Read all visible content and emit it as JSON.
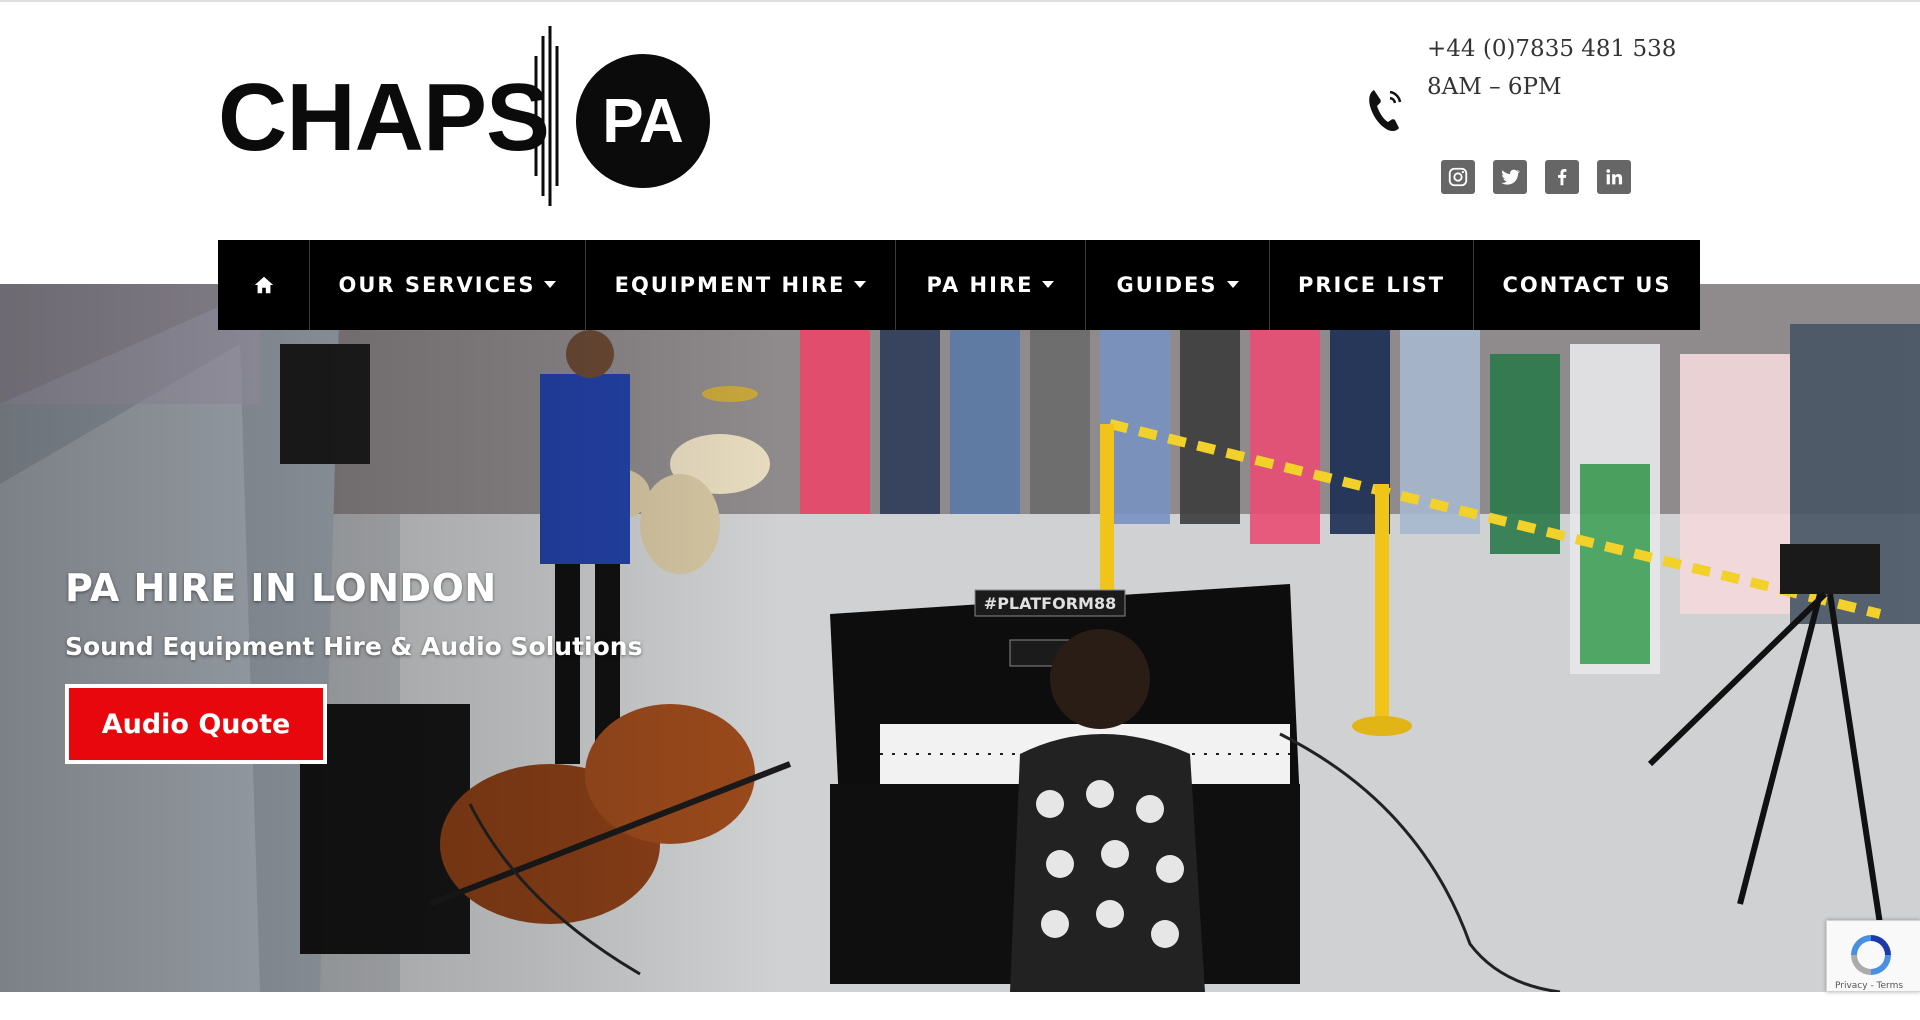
{
  "brand": {
    "name_left": "CHAPS",
    "name_right": "PA"
  },
  "contact": {
    "phone": "+44 (0)7835 481 538",
    "hours": "8AM – 6PM",
    "icon": "phone-icon"
  },
  "socials": [
    {
      "name": "instagram",
      "icon": "instagram-icon"
    },
    {
      "name": "twitter",
      "icon": "twitter-icon"
    },
    {
      "name": "facebook",
      "icon": "facebook-icon"
    },
    {
      "name": "linkedin",
      "icon": "linkedin-icon"
    }
  ],
  "nav": {
    "home_icon": "home-icon",
    "items": [
      {
        "label": "OUR SERVICES",
        "dropdown": true
      },
      {
        "label": "EQUIPMENT HIRE",
        "dropdown": true
      },
      {
        "label": "PA HIRE",
        "dropdown": true
      },
      {
        "label": "GUIDES",
        "dropdown": true
      },
      {
        "label": "PRICE LIST",
        "dropdown": false
      },
      {
        "label": "CONTACT US",
        "dropdown": false
      }
    ]
  },
  "hero": {
    "title": "PA HIRE IN LONDON",
    "subtitle": "Sound Equipment Hire & Audio Solutions",
    "cta": "Audio Quote",
    "piano_sign": "#PLATFORM88"
  },
  "recaptcha": {
    "text": "Privacy - Terms"
  },
  "colors": {
    "accent": "#e8070d",
    "nav_bg": "#000000",
    "text": "#333333",
    "social": "#666666"
  }
}
